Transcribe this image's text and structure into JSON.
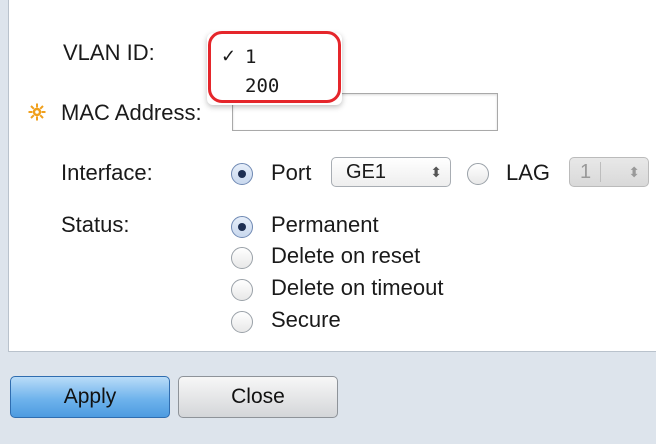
{
  "form": {
    "vlan_id_label": "VLAN ID:",
    "vlan_options": [
      "1",
      "200"
    ],
    "vlan_selected_check": "✓",
    "mac_label": "MAC Address:",
    "mac_value": "",
    "interface_label": "Interface:",
    "interface_port_label": "Port",
    "interface_port_value": "GE1",
    "interface_lag_label": "LAG",
    "interface_lag_value": "1",
    "interface_selected": "Port",
    "status_label": "Status:",
    "status_options": [
      "Permanent",
      "Delete on reset",
      "Delete on timeout",
      "Secure"
    ],
    "status_selected": "Permanent"
  },
  "buttons": {
    "apply": "Apply",
    "close": "Close"
  },
  "colors": {
    "highlight": "#e5262b",
    "required_icon": "#f0a01c",
    "apply_button": "#6fb3ec"
  }
}
